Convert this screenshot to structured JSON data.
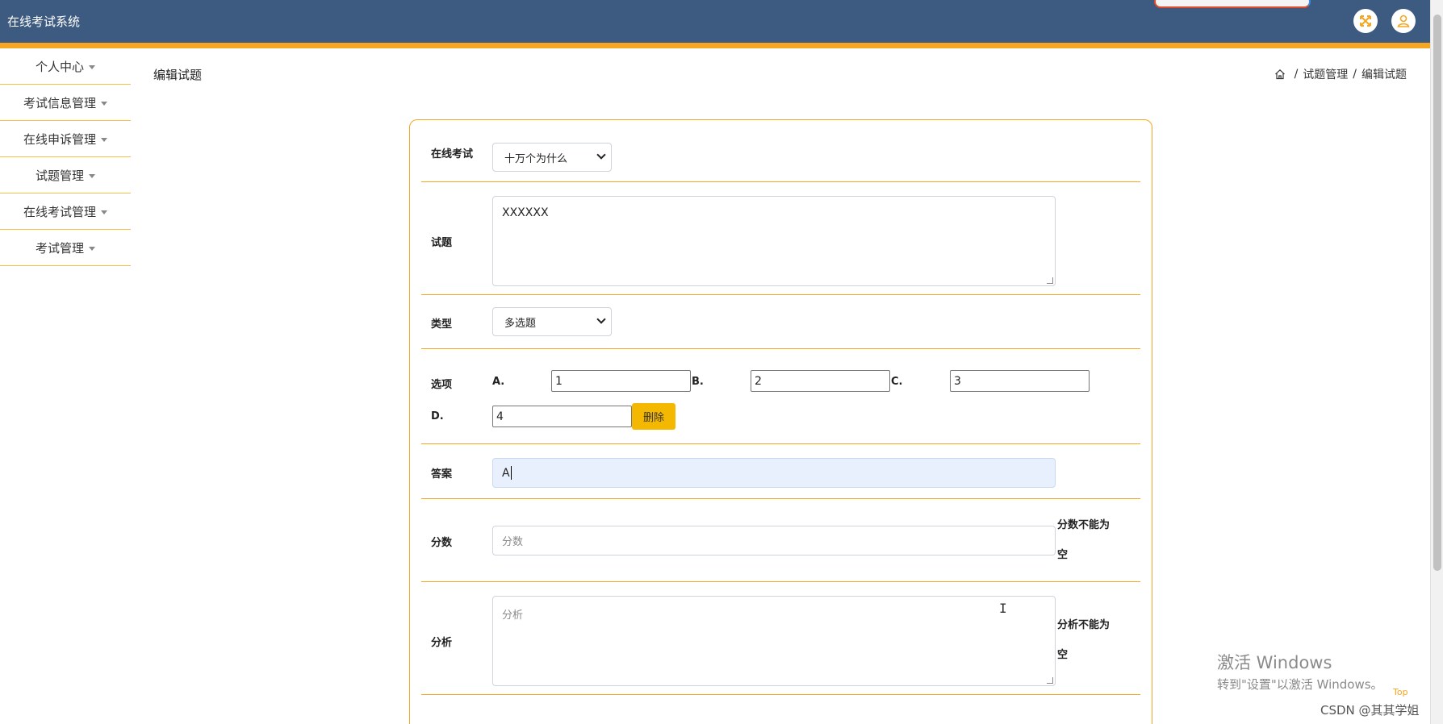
{
  "app": {
    "title": "在线考试系统"
  },
  "header": {
    "buttons": [
      {
        "icon": "fullscreen-icon",
        "accent": "#f5a623"
      },
      {
        "icon": "user-icon",
        "accent": "#f5a623"
      }
    ]
  },
  "colors": {
    "header_bg": "#3d5a80",
    "accent": "#f5a623",
    "button": "#f5b800"
  },
  "sidebar": {
    "items": [
      {
        "label": "个人中心"
      },
      {
        "label": "考试信息管理"
      },
      {
        "label": "在线申诉管理"
      },
      {
        "label": "试题管理"
      },
      {
        "label": "在线考试管理"
      },
      {
        "label": "考试管理"
      }
    ]
  },
  "page": {
    "title": "编辑试题"
  },
  "breadcrumb": {
    "icon": "home-icon",
    "items": [
      "试题管理",
      "编辑试题"
    ],
    "separator": "/"
  },
  "form": {
    "exam": {
      "label": "在线考试",
      "selected": "十万个为什么"
    },
    "question": {
      "label": "试题",
      "value": "XXXXXX"
    },
    "type": {
      "label": "类型",
      "selected": "多选题"
    },
    "options": {
      "label": "选项",
      "items": [
        {
          "letter": "A.",
          "value": "1"
        },
        {
          "letter": "B.",
          "value": "2"
        },
        {
          "letter": "C.",
          "value": "3"
        },
        {
          "letter": "D.",
          "value": "4"
        }
      ],
      "delete_label": "删除"
    },
    "answer": {
      "label": "答案",
      "value": "A"
    },
    "score": {
      "label": "分数",
      "placeholder": "分数",
      "hint_line1": "分数不能为",
      "hint_line2": "空"
    },
    "analysis": {
      "label": "分析",
      "placeholder": "分析",
      "hint_line1": "分析不能为",
      "hint_line2": "空"
    }
  },
  "watermark": {
    "line1": "激活 Windows",
    "line2": "转到\"设置\"以激活 Windows。",
    "top_link": "Top",
    "csdn": "CSDN @其其学姐"
  }
}
